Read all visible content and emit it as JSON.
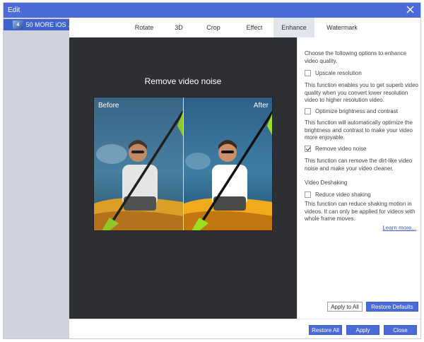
{
  "window": {
    "title": "Edit"
  },
  "sidebar": {
    "items": [
      {
        "thumb": "4",
        "label": "50 MORE iOS ..."
      }
    ]
  },
  "tabs": [
    {
      "label": "Rotate"
    },
    {
      "label": "3D"
    },
    {
      "label": "Crop"
    },
    {
      "label": "Effect"
    },
    {
      "label": "Enhance",
      "active": true
    },
    {
      "label": "Watermark"
    }
  ],
  "preview": {
    "title": "Remove video noise",
    "before_label": "Before",
    "after_label": "After"
  },
  "settings": {
    "intro": "Choose the following options to enhance video quality.",
    "options": [
      {
        "label": "Upscale resolution",
        "checked": false,
        "description": "This function enables you to get superb video quality when you convert lower resolution video to higher resolution video."
      },
      {
        "label": "Optimize brightness and contrast",
        "checked": false,
        "description": "This function will automatically optimize the brightness and contrast to make your video more enjoyable."
      },
      {
        "label": "Remove video noise",
        "checked": true,
        "description": "This function can remove the dirt-like video noise and make your video cleaner."
      }
    ],
    "deshaking_heading": "Video Deshaking",
    "deshaking": {
      "label": "Reduce video shaking",
      "checked": false,
      "description": "This function can reduce shaking motion in videos. It can only be applied for videos with whole frame moves."
    },
    "learn_more": "Learn more...",
    "apply_all": "Apply to All",
    "restore_defaults": "Restore Defaults"
  },
  "footer": {
    "restore_all": "Restore All",
    "apply": "Apply",
    "close": "Close"
  },
  "colors": {
    "accent": "#4a6bd8",
    "sidebar_bg": "#cdd2dc",
    "preview_bg": "#2d2f33",
    "link": "#3a5fc8"
  },
  "icons": {
    "close": "close-icon",
    "check": "checkmark-icon"
  }
}
